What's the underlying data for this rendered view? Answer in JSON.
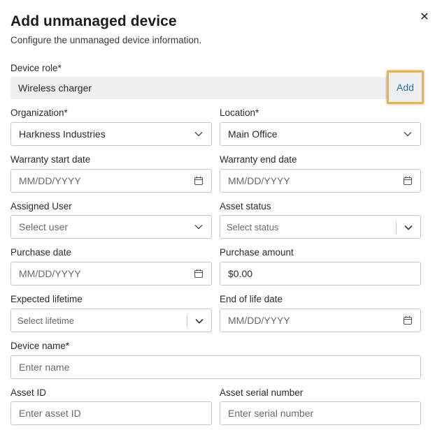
{
  "dialog": {
    "title": "Add unmanaged device",
    "subtitle": "Configure the unmanaged device information.",
    "close_glyph": "✕"
  },
  "device_role": {
    "label": "Device role*",
    "value": "Wireless charger",
    "add_label": "Add"
  },
  "organization": {
    "label": "Organization*",
    "value": "Harkness Industries"
  },
  "location": {
    "label": "Location*",
    "value": "Main Office"
  },
  "warranty_start": {
    "label": "Warranty start date",
    "placeholder": "MM/DD/YYYY"
  },
  "warranty_end": {
    "label": "Warranty end date",
    "placeholder": "MM/DD/YYYY"
  },
  "assigned_user": {
    "label": "Assigned User",
    "placeholder": "Select user"
  },
  "asset_status": {
    "label": "Asset status",
    "placeholder": "Select status"
  },
  "purchase_date": {
    "label": "Purchase date",
    "placeholder": "MM/DD/YYYY"
  },
  "purchase_amount": {
    "label": "Purchase amount",
    "value": "$0.00"
  },
  "expected_lifetime": {
    "label": "Expected lifetime",
    "placeholder": "Select lifetime"
  },
  "end_of_life": {
    "label": "End of life date",
    "placeholder": "MM/DD/YYYY"
  },
  "device_name": {
    "label": "Device name*",
    "placeholder": "Enter name"
  },
  "asset_id": {
    "label": "Asset ID",
    "placeholder": "Enter asset ID"
  },
  "serial_number": {
    "label": "Asset serial number",
    "placeholder": "Enter serial number"
  },
  "colors": {
    "accent_link": "#2e6fb0",
    "highlight_border": "#f0b43a",
    "field_border": "#c9c9c9",
    "role_bar_bg": "#eff0f1"
  }
}
